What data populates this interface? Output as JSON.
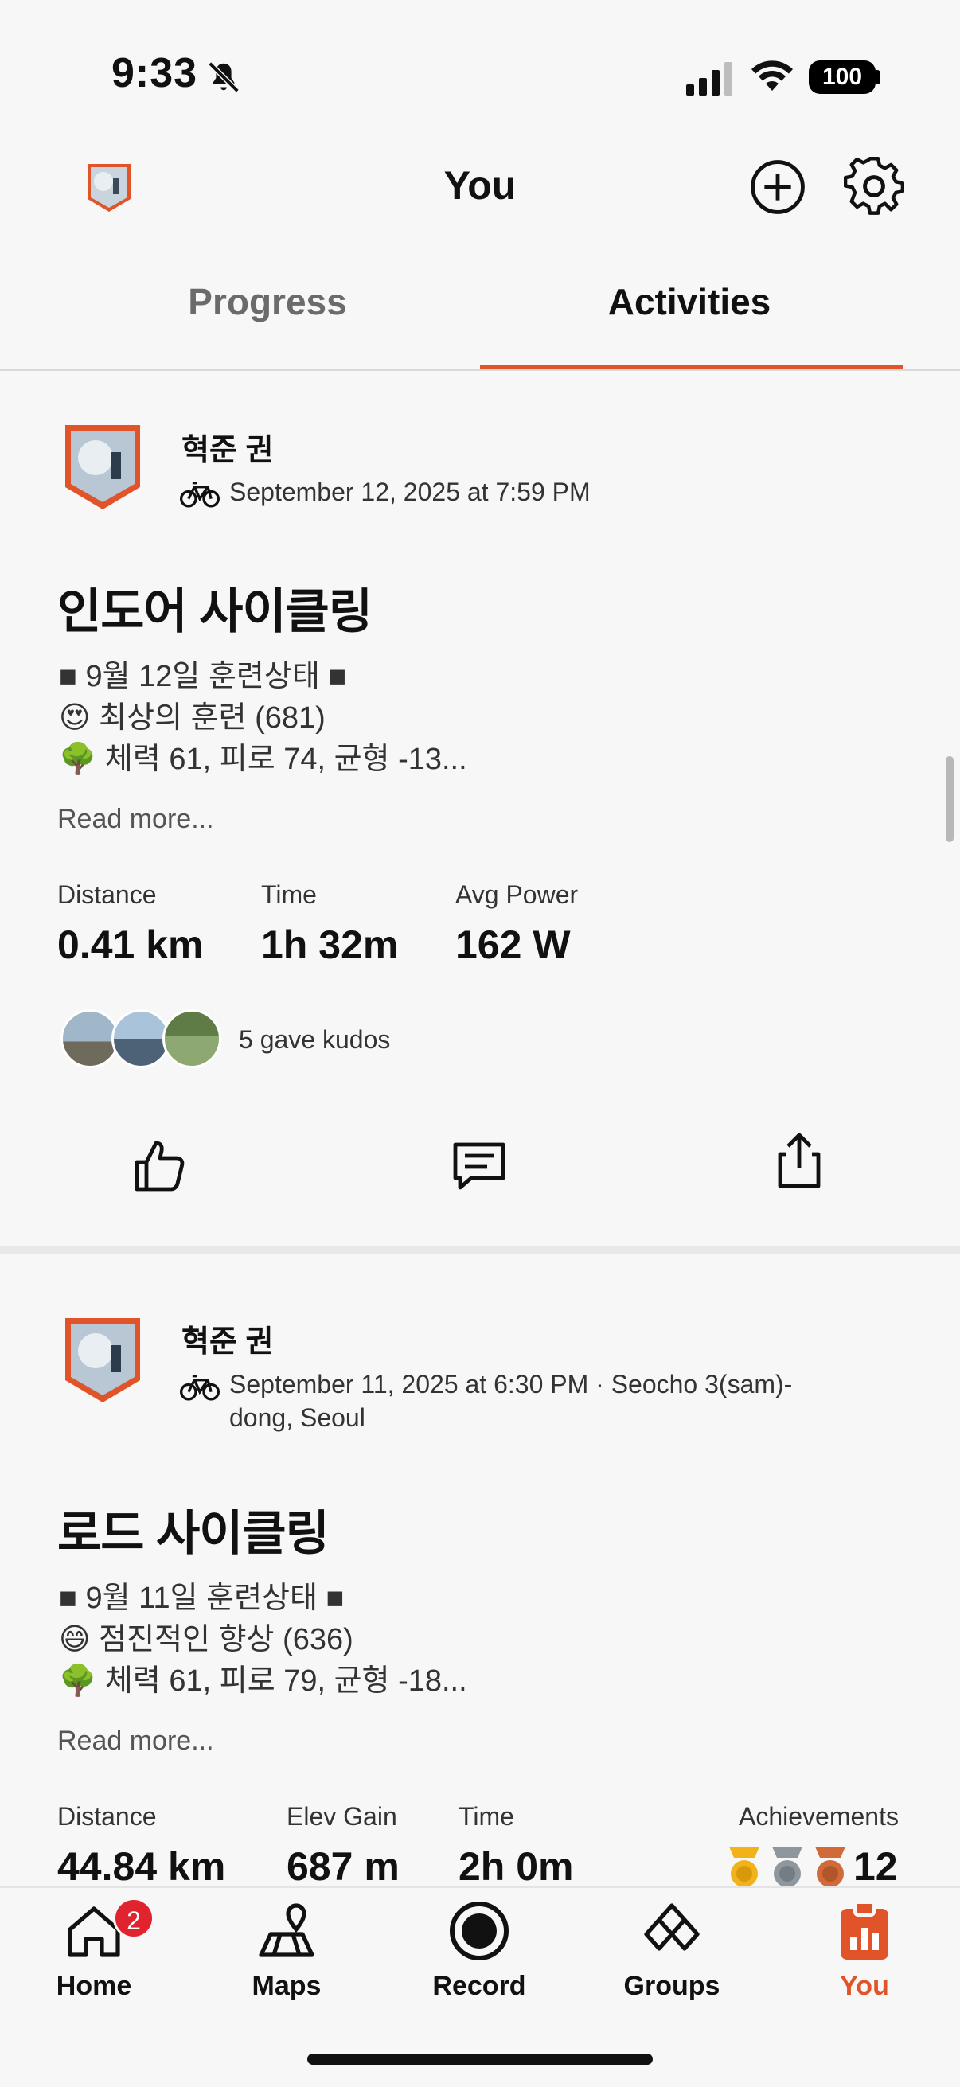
{
  "status_bar": {
    "time": "9:33",
    "battery": "100"
  },
  "header": {
    "title": "You"
  },
  "tabs": [
    {
      "label": "Progress",
      "active": false
    },
    {
      "label": "Activities",
      "active": true
    }
  ],
  "colors": {
    "accent": "#e1542a",
    "badge": "#e0232e"
  },
  "activities": [
    {
      "athlete": "혁준 권",
      "meta": "September 12, 2025 at 7:59 PM",
      "title": "인도어 사이클링",
      "desc": [
        "■ 9월 12일 훈련상태 ■",
        "😍 최상의 훈련 (681)",
        "🌳 체력 61, 피로 74, 균형 -13..."
      ],
      "read_more": "Read more...",
      "stats": [
        {
          "label": "Distance",
          "value": "0.41 km"
        },
        {
          "label": "Time",
          "value": "1h 32m"
        },
        {
          "label": "Avg Power",
          "value": "162 W"
        }
      ],
      "kudos": "5 gave kudos"
    },
    {
      "athlete": "혁준 권",
      "meta_line1": "September 11, 2025 at 6:30 PM · Seocho 3(sam)-",
      "meta_line2": "dong, Seoul",
      "title": "로드 사이클링",
      "desc": [
        "■ 9월 11일 훈련상태 ■",
        "😄 점진적인 향상 (636)",
        "🌳 체력 61, 피로 79, 균형 -18..."
      ],
      "read_more": "Read more...",
      "stats": [
        {
          "label": "Distance",
          "value": "44.84 km"
        },
        {
          "label": "Elev Gain",
          "value": "687 m"
        },
        {
          "label": "Time",
          "value": "2h 0m"
        },
        {
          "label": "Achievements",
          "value": "12"
        }
      ]
    }
  ],
  "nav": [
    {
      "label": "Home",
      "badge": "2",
      "icon": "home-icon"
    },
    {
      "label": "Maps",
      "icon": "maps-icon"
    },
    {
      "label": "Record",
      "icon": "record-icon"
    },
    {
      "label": "Groups",
      "icon": "groups-icon"
    },
    {
      "label": "You",
      "icon": "you-icon",
      "active": true
    }
  ]
}
